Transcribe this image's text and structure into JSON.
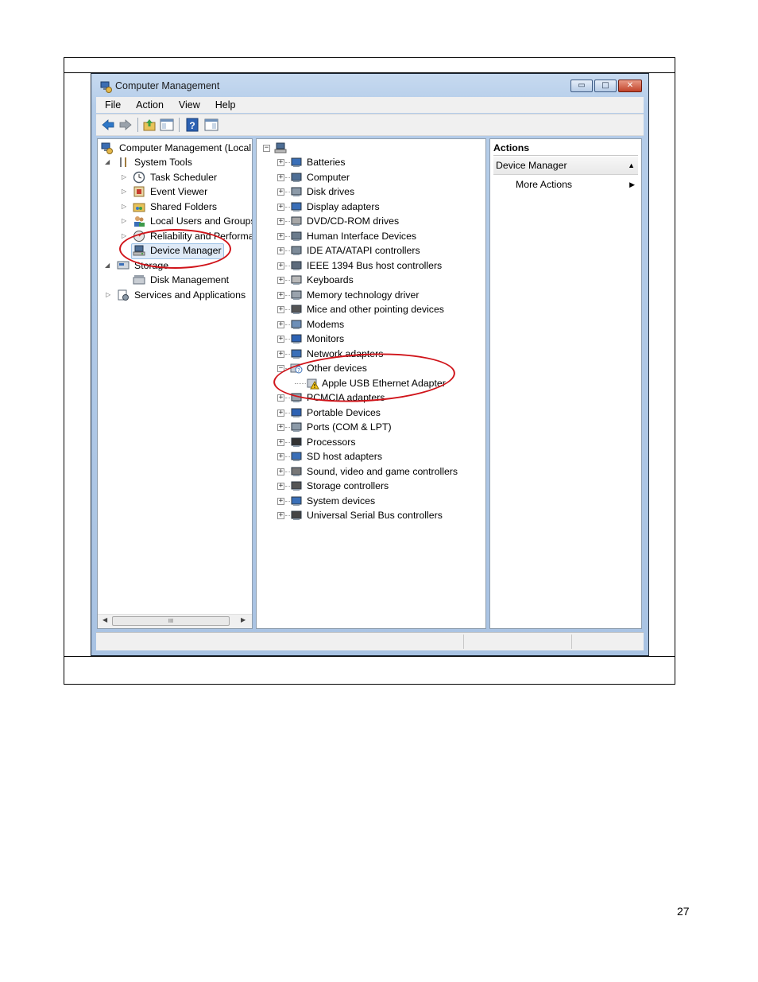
{
  "window": {
    "title": "Computer Management",
    "caption_buttons": [
      {
        "name": "minimize-button",
        "glyph": "▭"
      },
      {
        "name": "maximize-button",
        "glyph": "□"
      },
      {
        "name": "close-button",
        "glyph": "✕"
      }
    ]
  },
  "menu": [
    "File",
    "Action",
    "View",
    "Help"
  ],
  "toolbar": {
    "buttons": [
      "back-icon",
      "forward-icon",
      "up-folder-icon",
      "show-hide-tree-icon",
      "help-icon",
      "show-hide-action-pane-icon"
    ]
  },
  "left_tree": {
    "root": "Computer Management (Local",
    "items": [
      {
        "label": "System Tools",
        "expander": "◢"
      },
      {
        "label": "Task Scheduler",
        "expander": "▷"
      },
      {
        "label": "Event Viewer",
        "expander": "▷"
      },
      {
        "label": "Shared Folders",
        "expander": "▷"
      },
      {
        "label": "Local Users and Groups",
        "expander": "▷"
      },
      {
        "label": "Reliability and Performa",
        "expander": "▷"
      },
      {
        "label": "Device Manager",
        "expander": "",
        "selected": true
      },
      {
        "label": "Storage",
        "expander": "◢"
      },
      {
        "label": "Disk Management",
        "expander": ""
      },
      {
        "label": "Services and Applications",
        "expander": "▷"
      }
    ],
    "scroll_thumb": "III"
  },
  "device_tree": {
    "categories": [
      "Batteries",
      "Computer",
      "Disk drives",
      "Display adapters",
      "DVD/CD-ROM drives",
      "Human Interface Devices",
      "IDE ATA/ATAPI controllers",
      "IEEE 1394 Bus host controllers",
      "Keyboards",
      "Memory technology driver",
      "Mice and other pointing devices",
      "Modems",
      "Monitors",
      "Network adapters",
      "Other devices",
      "Apple USB Ethernet Adapter",
      "PCMCIA adapters",
      "Portable Devices",
      "Ports (COM & LPT)",
      "Processors",
      "SD host adapters",
      "Sound, video and game controllers",
      "Storage controllers",
      "System devices",
      "Universal Serial Bus controllers"
    ],
    "warning_device": "Apple USB Ethernet Adapter"
  },
  "actions": {
    "header": "Actions",
    "section": "Device Manager",
    "section_arrow": "▲",
    "more": "More Actions",
    "more_arrow": "▶"
  },
  "page_number": "27",
  "colors": {
    "annotation_red": "#d0141a",
    "selection_bg": "#dfeaf7"
  }
}
